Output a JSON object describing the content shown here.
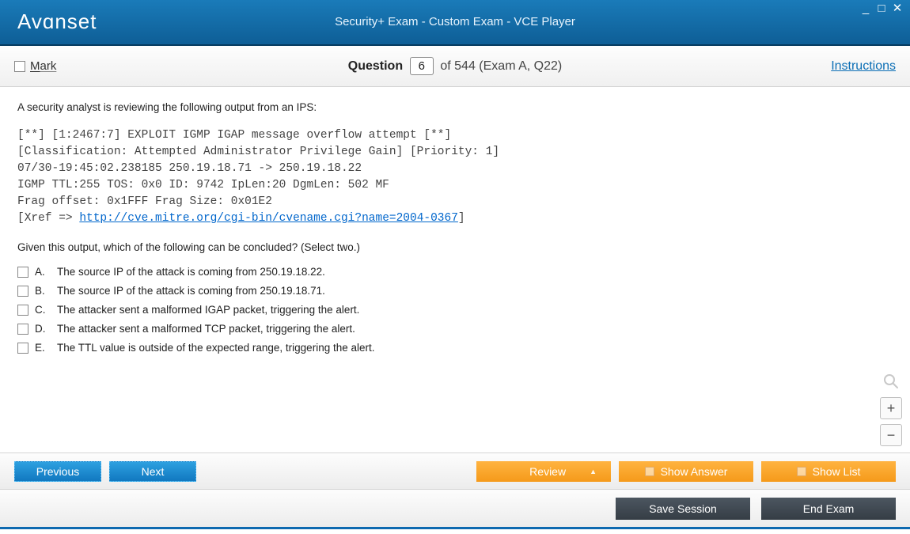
{
  "titlebar": {
    "logo": "Avɑnset",
    "title": "Security+ Exam - Custom Exam - VCE Player"
  },
  "header": {
    "mark_label": "Mark",
    "question_label": "Question",
    "question_num": "6",
    "question_suffix": "of 544 (Exam A, Q22)",
    "instructions_label": "Instructions"
  },
  "question": {
    "intro": "A security analyst is reviewing the following output from an IPS:",
    "code_line1": "[**] [1:2467:7] EXPLOIT IGMP IGAP message overflow attempt [**]",
    "code_line2": "[Classification: Attempted Administrator Privilege Gain] [Priority: 1]",
    "code_line3": "07/30-19:45:02.238185 250.19.18.71 -> 250.19.18.22",
    "code_line4": "IGMP TTL:255 TOS: 0x0 ID: 9742 IpLen:20 DgmLen: 502 MF",
    "code_line5": "Frag offset: 0x1FFF Frag Size: 0x01E2",
    "code_line6_prefix": "[Xref => ",
    "code_line6_link": "http://cve.mitre.org/cgi-bin/cvename.cgi?name=2004-0367",
    "code_line6_suffix": "]",
    "prompt": "Given this output, which of the following can be concluded? (Select two.)",
    "options": [
      {
        "letter": "A.",
        "text": "The source IP of the attack is coming from 250.19.18.22."
      },
      {
        "letter": "B.",
        "text": "The source IP of the attack is coming from 250.19.18.71."
      },
      {
        "letter": "C.",
        "text": "The attacker sent a malformed IGAP packet, triggering the alert."
      },
      {
        "letter": "D.",
        "text": "The attacker sent a malformed TCP packet, triggering the alert."
      },
      {
        "letter": "E.",
        "text": "The TTL value is outside of the expected range, triggering the alert."
      }
    ]
  },
  "nav": {
    "previous": "Previous",
    "next": "Next",
    "review": "Review",
    "show_answer": "Show Answer",
    "show_list": "Show List"
  },
  "footer": {
    "save_session": "Save Session",
    "end_exam": "End Exam"
  },
  "zoom": {
    "plus": "+",
    "minus": "−"
  }
}
